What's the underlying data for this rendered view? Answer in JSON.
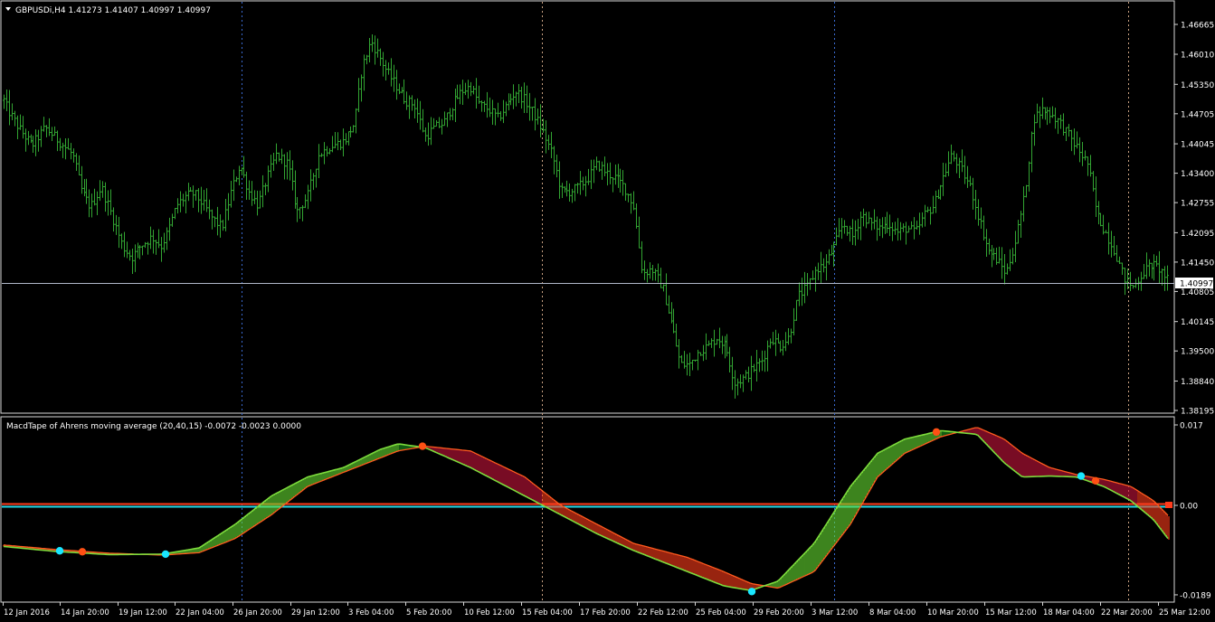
{
  "colors": {
    "background": "#000000",
    "frame": "#d8d8d8",
    "price_bars": "#32a532",
    "separators": "#2f4f8f",
    "bid_line": "#b0b8c8",
    "tape_up_light": "#66dd33",
    "tape_up_dark": "#1f9a1f",
    "tape_down_red": "#ff3c1c",
    "tape_down_crimson": "#c8143c",
    "macd_line": "#7ddc3c",
    "signal_line": "#ff5a1e",
    "dot_up": "#19e6ff",
    "dot_down": "#ff5014",
    "zero_red": "#ff3c1c",
    "zero_cyan": "#23d6e6"
  },
  "main_panel": {
    "header": "GBPUSDi,H4  1.41273 1.41407 1.40997 1.40997",
    "current_price": "1.40997",
    "price_axis": [
      "1.46665",
      "1.46010",
      "1.45350",
      "1.44705",
      "1.44045",
      "1.43400",
      "1.42755",
      "1.42095",
      "1.41450",
      "1.40805",
      "1.40145",
      "1.39500",
      "1.38840",
      "1.38195"
    ]
  },
  "indicator_panel": {
    "header": "MacdTape of Ahrens moving average (20,40,15) -0.0072 -0.0023 0.0000",
    "axis": [
      "0.017",
      "0.00",
      "-0.0189"
    ]
  },
  "time_axis": [
    "12 Jan 2016",
    "14 Jan 20:00",
    "19 Jan 12:00",
    "22 Jan 04:00",
    "26 Jan 20:00",
    "29 Jan 12:00",
    "3 Feb 04:00",
    "5 Feb 20:00",
    "10 Feb 12:00",
    "15 Feb 04:00",
    "17 Feb 20:00",
    "22 Feb 12:00",
    "25 Feb 04:00",
    "29 Feb 20:00",
    "3 Mar 12:00",
    "8 Mar 04:00",
    "10 Mar 20:00",
    "15 Mar 12:00",
    "18 Mar 04:00",
    "22 Mar 20:00",
    "25 Mar 12:00"
  ],
  "chart_data": [
    {
      "type": "ohlc",
      "symbol": "GBPUSDi",
      "timeframe": "H4",
      "last_bar": {
        "open": 1.41273,
        "high": 1.41407,
        "low": 1.40997,
        "close": 1.40997
      },
      "ylim": [
        1.3805,
        1.4685
      ],
      "close_path": [
        [
          0,
          1.452
        ],
        [
          8,
          1.448
        ],
        [
          20,
          1.444
        ],
        [
          35,
          1.44
        ],
        [
          50,
          1.444
        ],
        [
          65,
          1.441
        ],
        [
          80,
          1.438
        ],
        [
          90,
          1.43
        ],
        [
          100,
          1.4265
        ],
        [
          112,
          1.431
        ],
        [
          123,
          1.425
        ],
        [
          135,
          1.418
        ],
        [
          145,
          1.4155
        ],
        [
          155,
          1.418
        ],
        [
          168,
          1.42
        ],
        [
          178,
          1.418
        ],
        [
          185,
          1.421
        ],
        [
          195,
          1.427
        ],
        [
          205,
          1.429
        ],
        [
          215,
          1.4295
        ],
        [
          225,
          1.427
        ],
        [
          235,
          1.424
        ],
        [
          245,
          1.422
        ],
        [
          255,
          1.43
        ],
        [
          265,
          1.436
        ],
        [
          275,
          1.43
        ],
        [
          285,
          1.427
        ],
        [
          295,
          1.433
        ],
        [
          305,
          1.438
        ],
        [
          318,
          1.436
        ],
        [
          328,
          1.4255
        ],
        [
          340,
          1.429
        ],
        [
          352,
          1.438
        ],
        [
          365,
          1.44
        ],
        [
          380,
          1.441
        ],
        [
          392,
          1.445
        ],
        [
          400,
          1.457
        ],
        [
          410,
          1.463
        ],
        [
          418,
          1.46
        ],
        [
          428,
          1.456
        ],
        [
          438,
          1.453
        ],
        [
          448,
          1.45
        ],
        [
          458,
          1.449
        ],
        [
          470,
          1.442
        ],
        [
          480,
          1.444
        ],
        [
          490,
          1.445
        ],
        [
          500,
          1.449
        ],
        [
          510,
          1.452
        ],
        [
          520,
          1.453
        ],
        [
          530,
          1.449
        ],
        [
          540,
          1.448
        ],
        [
          550,
          1.446
        ],
        [
          560,
          1.449
        ],
        [
          570,
          1.452
        ],
        [
          580,
          1.45
        ],
        [
          590,
          1.447
        ],
        [
          600,
          1.443
        ],
        [
          610,
          1.438
        ],
        [
          620,
          1.43
        ],
        [
          630,
          1.43
        ],
        [
          640,
          1.431
        ],
        [
          650,
          1.433
        ],
        [
          660,
          1.436
        ],
        [
          670,
          1.434
        ],
        [
          680,
          1.433
        ],
        [
          690,
          1.431
        ],
        [
          700,
          1.427
        ],
        [
          710,
          1.412
        ],
        [
          720,
          1.413
        ],
        [
          732,
          1.409
        ],
        [
          742,
          1.401
        ],
        [
          752,
          1.392
        ],
        [
          762,
          1.392
        ],
        [
          772,
          1.395
        ],
        [
          782,
          1.396
        ],
        [
          792,
          1.398
        ],
        [
          802,
          1.396
        ],
        [
          812,
          1.388
        ],
        [
          822,
          1.389
        ],
        [
          832,
          1.391
        ],
        [
          842,
          1.393
        ],
        [
          852,
          1.398
        ],
        [
          862,
          1.396
        ],
        [
          872,
          1.398
        ],
        [
          882,
          1.407
        ],
        [
          892,
          1.409
        ],
        [
          902,
          1.413
        ],
        [
          912,
          1.414
        ],
        [
          922,
          1.418
        ],
        [
          932,
          1.423
        ],
        [
          942,
          1.42
        ],
        [
          952,
          1.425
        ],
        [
          962,
          1.423
        ],
        [
          972,
          1.422
        ],
        [
          982,
          1.423
        ],
        [
          992,
          1.421
        ],
        [
          1002,
          1.422
        ],
        [
          1012,
          1.421
        ],
        [
          1022,
          1.425
        ],
        [
          1032,
          1.427
        ],
        [
          1042,
          1.433
        ],
        [
          1052,
          1.438
        ],
        [
          1062,
          1.435
        ],
        [
          1072,
          1.431
        ],
        [
          1082,
          1.424
        ],
        [
          1092,
          1.417
        ],
        [
          1102,
          1.415
        ],
        [
          1112,
          1.412
        ],
        [
          1122,
          1.419
        ],
        [
          1132,
          1.429
        ],
        [
          1142,
          1.446
        ],
        [
          1152,
          1.448
        ],
        [
          1162,
          1.447
        ],
        [
          1172,
          1.445
        ],
        [
          1182,
          1.442
        ],
        [
          1192,
          1.439
        ],
        [
          1202,
          1.436
        ],
        [
          1212,
          1.425
        ],
        [
          1222,
          1.421
        ],
        [
          1232,
          1.417
        ],
        [
          1242,
          1.411
        ],
        [
          1252,
          1.409
        ],
        [
          1262,
          1.412
        ],
        [
          1272,
          1.414
        ],
        [
          1282,
          1.413
        ],
        [
          1292,
          1.41
        ]
      ]
    },
    {
      "type": "area",
      "title": "MacdTape of Ahrens moving average (20,40,15)",
      "values": {
        "macd": -0.0072,
        "signal": -0.0023,
        "zero": 0.0
      },
      "ylim": [
        -0.0195,
        0.0175
      ],
      "macd_path": [
        [
          0,
          -0.0086
        ],
        [
          60,
          -0.0097
        ],
        [
          120,
          -0.0104
        ],
        [
          180,
          -0.0103
        ],
        [
          220,
          -0.009
        ],
        [
          260,
          -0.004
        ],
        [
          300,
          0.002
        ],
        [
          340,
          0.006
        ],
        [
          380,
          0.008
        ],
        [
          420,
          0.0118
        ],
        [
          440,
          0.013
        ],
        [
          470,
          0.0122
        ],
        [
          520,
          0.008
        ],
        [
          580,
          0.002
        ],
        [
          620,
          -0.002
        ],
        [
          660,
          -0.006
        ],
        [
          700,
          -0.0095
        ],
        [
          760,
          -0.014
        ],
        [
          800,
          -0.017
        ],
        [
          830,
          -0.018
        ],
        [
          860,
          -0.016
        ],
        [
          900,
          -0.008
        ],
        [
          940,
          0.004
        ],
        [
          970,
          0.011
        ],
        [
          1000,
          0.014
        ],
        [
          1040,
          0.0158
        ],
        [
          1080,
          0.015
        ],
        [
          1110,
          0.009
        ],
        [
          1130,
          0.006
        ],
        [
          1160,
          0.0062
        ],
        [
          1190,
          0.006
        ],
        [
          1220,
          0.004
        ],
        [
          1250,
          0.001
        ],
        [
          1275,
          -0.003
        ],
        [
          1293,
          -0.0075
        ]
      ],
      "signal_path": [
        [
          0,
          -0.0083
        ],
        [
          60,
          -0.0093
        ],
        [
          120,
          -0.0101
        ],
        [
          180,
          -0.0105
        ],
        [
          220,
          -0.01
        ],
        [
          260,
          -0.007
        ],
        [
          300,
          -0.002
        ],
        [
          340,
          0.004
        ],
        [
          380,
          0.007
        ],
        [
          420,
          0.01
        ],
        [
          440,
          0.0115
        ],
        [
          470,
          0.0125
        ],
        [
          520,
          0.0115
        ],
        [
          580,
          0.006
        ],
        [
          620,
          0.0
        ],
        [
          660,
          -0.004
        ],
        [
          700,
          -0.008
        ],
        [
          760,
          -0.011
        ],
        [
          800,
          -0.014
        ],
        [
          830,
          -0.0165
        ],
        [
          860,
          -0.0175
        ],
        [
          900,
          -0.014
        ],
        [
          940,
          -0.004
        ],
        [
          970,
          0.006
        ],
        [
          1000,
          0.011
        ],
        [
          1040,
          0.0145
        ],
        [
          1080,
          0.0165
        ],
        [
          1110,
          0.014
        ],
        [
          1130,
          0.011
        ],
        [
          1160,
          0.008
        ],
        [
          1190,
          0.0065
        ],
        [
          1220,
          0.0055
        ],
        [
          1250,
          0.004
        ],
        [
          1275,
          0.001
        ],
        [
          1293,
          -0.0025
        ]
      ],
      "signal_dots": [
        {
          "x": 66,
          "v": -0.0096,
          "kind": "up"
        },
        {
          "x": 91,
          "v": -0.0098,
          "kind": "down"
        },
        {
          "x": 183,
          "v": -0.0103,
          "kind": "up"
        },
        {
          "x": 467,
          "v": 0.0125,
          "kind": "down"
        },
        {
          "x": 831,
          "v": -0.0182,
          "kind": "up"
        },
        {
          "x": 1035,
          "v": 0.0155,
          "kind": "down"
        },
        {
          "x": 1195,
          "v": 0.0062,
          "kind": "up"
        },
        {
          "x": 1211,
          "v": 0.0052,
          "kind": "down"
        }
      ]
    }
  ]
}
